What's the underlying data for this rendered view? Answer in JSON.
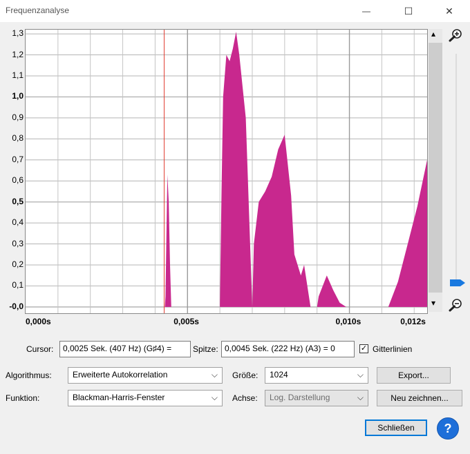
{
  "window": {
    "title": "Frequenzanalyse",
    "minimize": "—",
    "maximize": "☐",
    "close": "✕"
  },
  "plot": {
    "y_ticks": [
      "1,3",
      "1,2",
      "1,1",
      "1,0",
      "0,9",
      "0,8",
      "0,7",
      "0,6",
      "0,5",
      "0,4",
      "0,3",
      "0,2",
      "0,1",
      "-0,0"
    ],
    "bold_ticks": [
      "1,0",
      "0,5",
      "-0,0"
    ],
    "x_ticks": [
      "0,000s",
      "0,005s",
      "0,010s",
      "0,012s"
    ],
    "series_color": "#c8288e",
    "cursor_color": "#e03c31"
  },
  "chart_data": {
    "type": "area",
    "xlabel": "",
    "ylabel": "",
    "xlim": [
      0,
      0.0124
    ],
    "ylim": [
      -0.03,
      1.32
    ],
    "x": [
      0,
      0.0043,
      0.00432,
      0.00438,
      0.00442,
      0.00446,
      0.0045,
      0.006,
      0.00605,
      0.0061,
      0.0062,
      0.0063,
      0.0064,
      0.0065,
      0.0066,
      0.0068,
      0.007,
      0.00705,
      0.0072,
      0.0074,
      0.0076,
      0.0078,
      0.008,
      0.0082,
      0.0083,
      0.0084,
      0.0085,
      0.0086,
      0.0088,
      0.009,
      0.00905,
      0.0093,
      0.0095,
      0.0097,
      0.0099,
      0.0112,
      0.0115,
      0.0118,
      0.0121,
      0.0124
    ],
    "series": [
      {
        "values": [
          0,
          0,
          0.05,
          0.63,
          0.5,
          0.2,
          0,
          0,
          0.55,
          1.0,
          1.2,
          1.17,
          1.23,
          1.31,
          1.2,
          0.9,
          0,
          0.3,
          0.5,
          0.55,
          0.62,
          0.75,
          0.82,
          0.53,
          0.25,
          0.2,
          0.15,
          0.2,
          0,
          0,
          0.05,
          0.15,
          0.08,
          0.02,
          0,
          0,
          0.12,
          0.3,
          0.48,
          0.7
        ]
      }
    ]
  },
  "controls": {
    "cursor_label": "Cursor:",
    "cursor_value": "0,0025 Sek. (407 Hz) (G♯4) =",
    "peak_label": "Spitze:",
    "peak_value": "0,0045 Sek. (222 Hz) (A3) = 0",
    "grid_label": "Gitterlinien",
    "grid_checked": "✓",
    "algorithm_label": "Algorithmus:",
    "algorithm_value": "Erweiterte Autokorrelation",
    "size_label": "Größe:",
    "size_value": "1024",
    "export_button": "Export...",
    "function_label": "Funktion:",
    "function_value": "Blackman-Harris-Fenster",
    "axis_label": "Achse:",
    "axis_value": "Log. Darstellung",
    "redraw_button": "Neu zeichnen...",
    "close_button": "Schließen",
    "help_button": "?"
  },
  "icons": {
    "zoom_in": "zoom-in-icon",
    "zoom_out": "zoom-out-icon",
    "scroll_up": "▴",
    "scroll_down": "▾",
    "chevron": "⌵"
  }
}
